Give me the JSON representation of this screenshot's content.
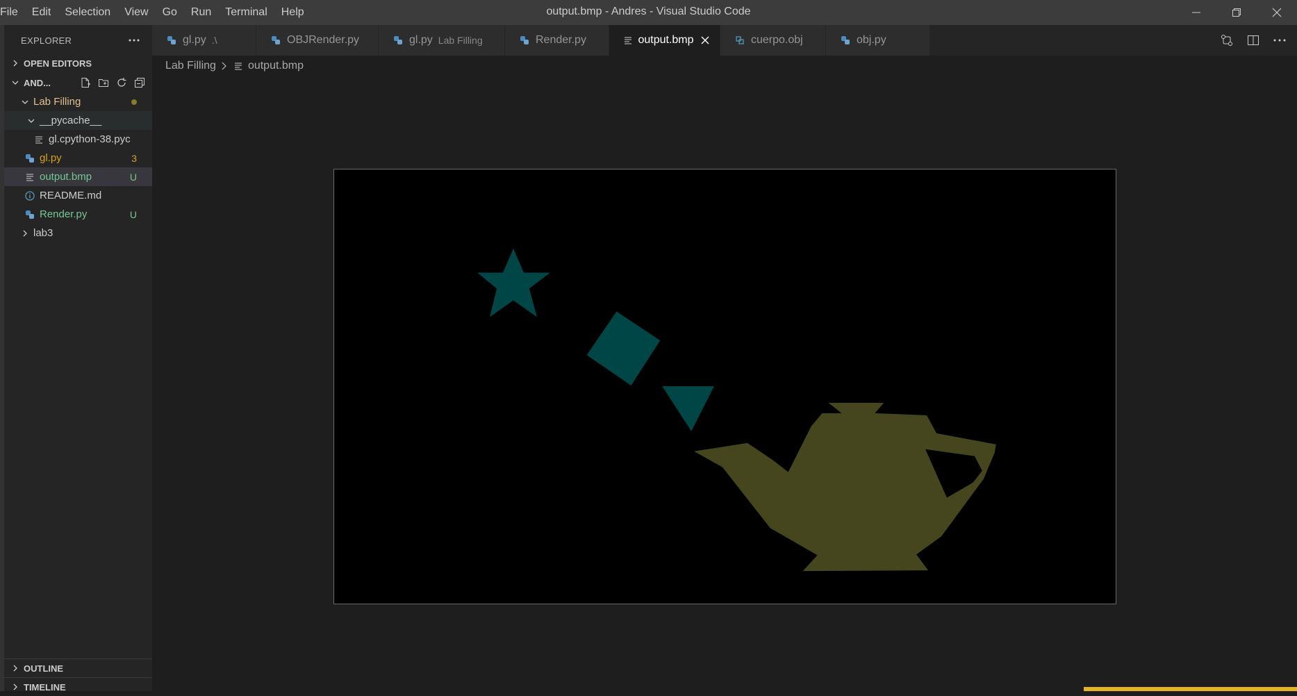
{
  "menu": [
    "File",
    "Edit",
    "Selection",
    "View",
    "Go",
    "Run",
    "Terminal",
    "Help"
  ],
  "window_title": "output.bmp - Andres - Visual Studio Code",
  "sidebar": {
    "title": "EXPLORER",
    "open_editors": "OPEN EDITORS",
    "folder": "AND...",
    "tree": [
      {
        "label": "Lab Filling",
        "type": "folder-open",
        "color": "#e2c08d",
        "indicator": "dot"
      },
      {
        "label": "__pycache__",
        "type": "folder-open",
        "color": "#cccccc"
      },
      {
        "label": "gl.cpython-38.pyc",
        "type": "file",
        "color": "#cccccc"
      },
      {
        "label": "gl.py",
        "type": "python",
        "color": "#e2c08d",
        "badge": "3"
      },
      {
        "label": "output.bmp",
        "type": "file",
        "color": "#73c991",
        "badge": "U"
      },
      {
        "label": "README.md",
        "type": "info",
        "color": "#cccccc"
      },
      {
        "label": "Render.py",
        "type": "python",
        "color": "#73c991",
        "badge": "U"
      },
      {
        "label": "lab3",
        "type": "folder-closed",
        "color": "#cccccc"
      }
    ],
    "outline": "OUTLINE",
    "timeline": "TIMELINE"
  },
  "tabs": [
    {
      "label": "gl.py",
      "desc": ".\\",
      "icon": "python-icon"
    },
    {
      "label": "OBJRender.py",
      "desc": "",
      "icon": "python-icon"
    },
    {
      "label": "gl.py",
      "desc": "Lab Filling",
      "icon": "python-icon"
    },
    {
      "label": "Render.py",
      "desc": "",
      "icon": "python-icon"
    },
    {
      "label": "output.bmp",
      "desc": "",
      "icon": "file-lines-icon",
      "active": true
    },
    {
      "label": "cuerpo.obj",
      "desc": "",
      "icon": "cube-icon"
    },
    {
      "label": "obj.py",
      "desc": "",
      "icon": "python-icon"
    }
  ],
  "breadcrumb": {
    "folder": "Lab Filling",
    "file": "output.bmp"
  },
  "image_colors": {
    "teal": "#004646",
    "olive": "#46461e",
    "background": "#000000"
  }
}
